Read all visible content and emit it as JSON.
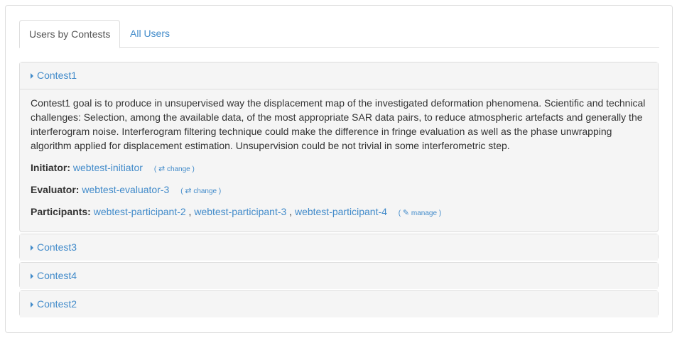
{
  "tabs": [
    {
      "label": "Users by Contests",
      "active": true
    },
    {
      "label": "All Users",
      "active": false
    }
  ],
  "contests": [
    {
      "title": "Contest1",
      "expanded": true,
      "description": "Contest1 goal is to produce in unsupervised way the displacement map of the investigated deformation phenomena. Scientific and technical challenges: Selection, among the available data, of the most appropriate SAR data pairs, to reduce atmospheric artefacts and generally the interferogram noise. Interferogram filtering technique could make the difference in fringe evaluation as well as the phase unwrapping algorithm applied for displacement estimation. Unsupervision could be not trivial in some interferometric step.",
      "initiator_label": "Initiator:",
      "initiator": "webtest-initiator",
      "initiator_action": "change",
      "evaluator_label": "Evaluator:",
      "evaluator": "webtest-evaluator-3",
      "evaluator_action": "change",
      "participants_label": "Participants:",
      "participants": [
        "webtest-participant-2",
        "webtest-participant-3",
        "webtest-participant-4"
      ],
      "participants_action": "manage"
    },
    {
      "title": "Contest3",
      "expanded": false
    },
    {
      "title": "Contest4",
      "expanded": false
    },
    {
      "title": "Contest2",
      "expanded": false
    }
  ],
  "icons": {
    "exchange": "⇄",
    "edit": "✎"
  }
}
